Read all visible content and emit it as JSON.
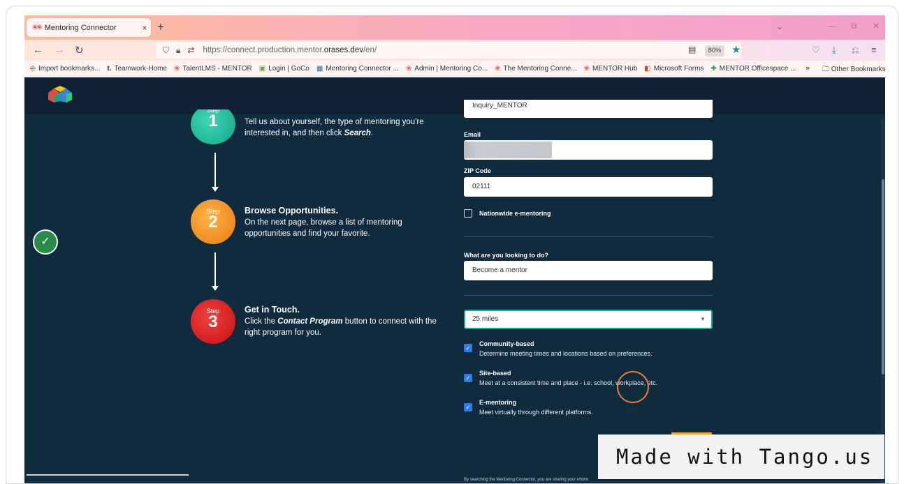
{
  "browser": {
    "tab_title": "Mentoring Connector",
    "tab_close": "×",
    "new_tab": "+",
    "tabs_list": "⌄",
    "win_min": "—",
    "win_restore": "⧉",
    "win_close": "✕",
    "back": "←",
    "forward": "→",
    "reload": "↻",
    "url_prefix": "https://connect.production.mentor.",
    "url_host": "orases.dev",
    "url_suffix": "/en/",
    "zoom": "80%",
    "bookmarks": [
      {
        "icon": "⎆",
        "label": "Import bookmarks..."
      },
      {
        "icon": "t.",
        "label": "Teamwork-Home"
      },
      {
        "icon": "❀",
        "label": "TalentLMS - MENTOR"
      },
      {
        "icon": "▣",
        "label": "Login | GoCo"
      },
      {
        "icon": "▦",
        "label": "Mentoring Connector ..."
      },
      {
        "icon": "❀",
        "label": "Admin | Mentoring Co..."
      },
      {
        "icon": "❀",
        "label": "The Mentoring Conne..."
      },
      {
        "icon": "❀",
        "label": "MENTOR Hub"
      },
      {
        "icon": "◧",
        "label": "Microsoft Forms"
      },
      {
        "icon": "✚",
        "label": "MENTOR Officespace ..."
      }
    ],
    "bookmarks_more": "»",
    "other_bookmarks": "Other Bookmarks"
  },
  "steps": [
    {
      "step_label": "Step",
      "number": "1",
      "heading": "",
      "text_before": "Tell us about yourself, the type of mentoring you're interested in, and then click ",
      "emph": "Search",
      "text_after": "."
    },
    {
      "step_label": "Step",
      "number": "2",
      "heading": "Browse Opportunities.",
      "text": "On the next page, browse a list of mentoring opportunities and find your favorite."
    },
    {
      "step_label": "Step",
      "number": "3",
      "heading": "Get in Touch.",
      "text_before": "Click the ",
      "emph": "Contact Program",
      "text_after": " button to connect with the right program for you."
    }
  ],
  "form": {
    "org_value": "Inquiry_MENTOR",
    "email_label": "Email",
    "zip_label": "ZIP Code",
    "zip_value": "02111",
    "nationwide_label": "Nationwide e-mentoring",
    "looking_label": "What are you looking to do?",
    "looking_value": "Become a mentor",
    "distance_value": "25 miles",
    "options": [
      {
        "title": "Community-based",
        "desc": "Determine meeting times and locations based on preferences."
      },
      {
        "title": "Site-based",
        "desc": "Meet at a consistent time and place - i.e. school, workplace, etc."
      },
      {
        "title": "E-mentoring",
        "desc": "Meet virtually through different platforms."
      }
    ],
    "disclaimer": "By searching the Mentoring Connector, you are sharing your inform"
  },
  "status": {
    "check": "✓"
  },
  "watermark": "Made with Tango.us",
  "colors": {
    "page_bg": "#102a3e",
    "step1": "#15a58a",
    "step2": "#e87a10",
    "step3": "#c41010",
    "checkbox": "#2d7be5"
  }
}
